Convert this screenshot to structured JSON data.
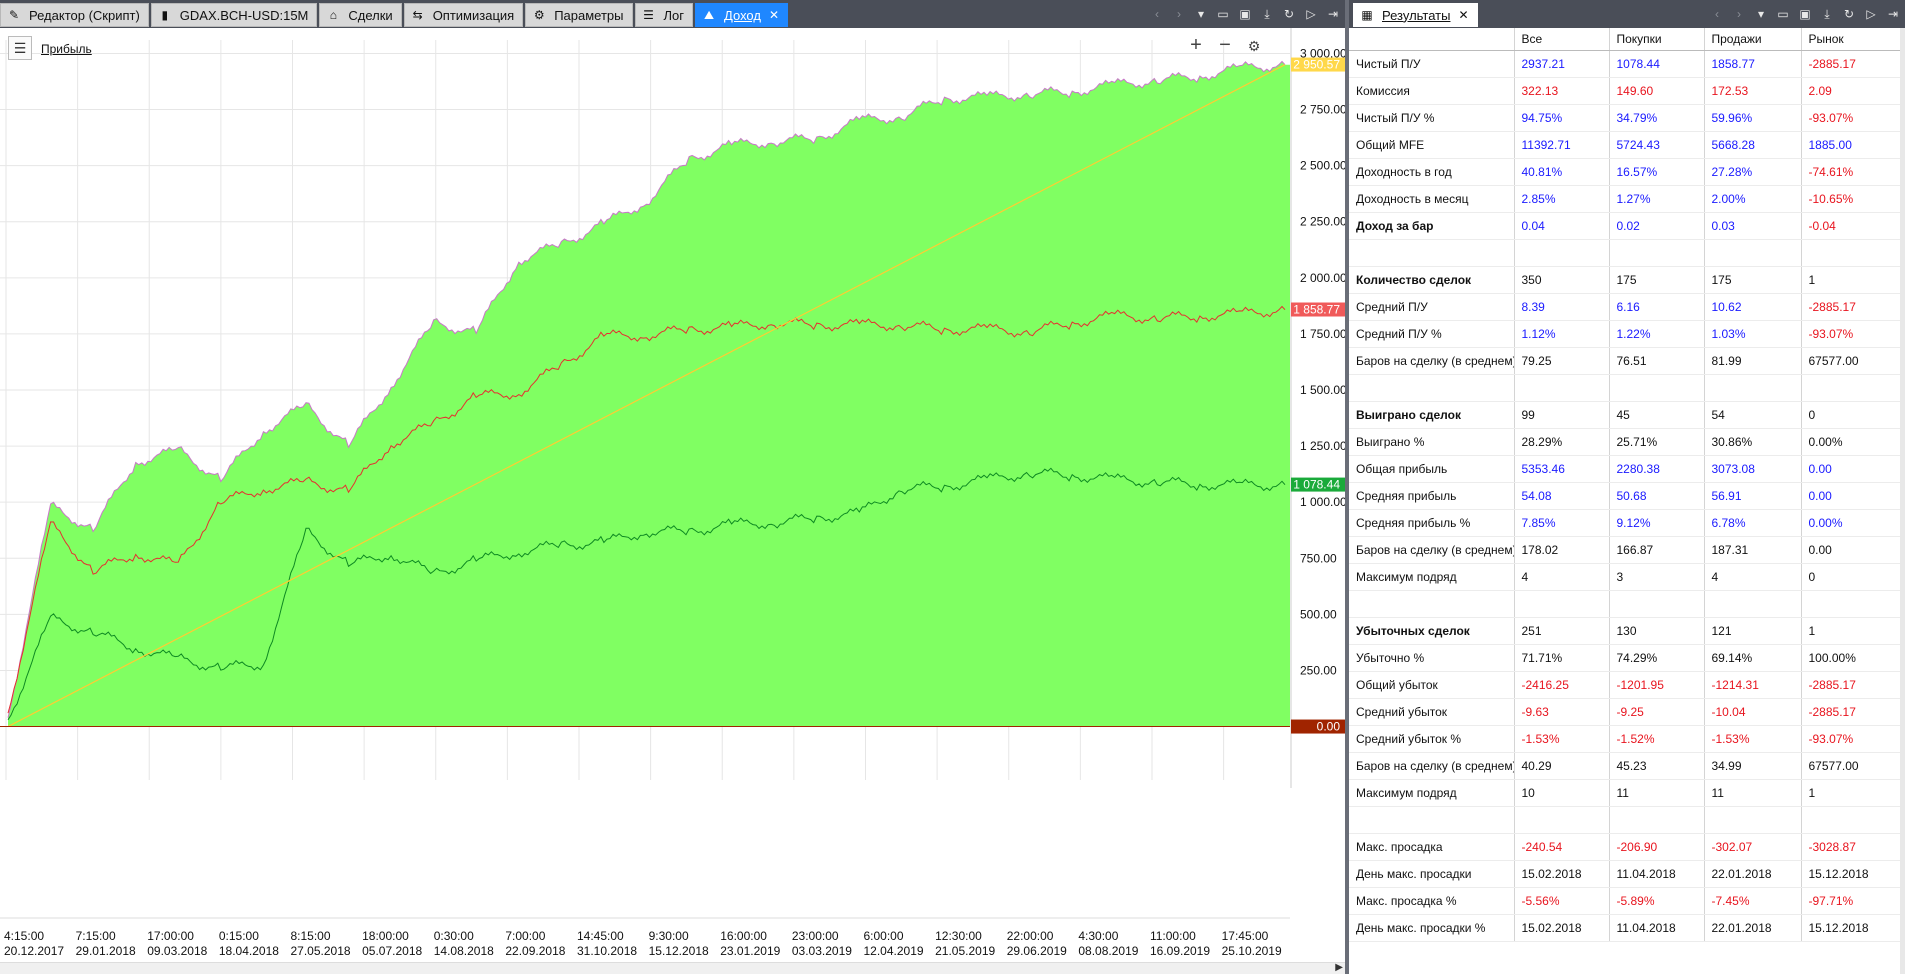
{
  "left_tabs": [
    {
      "label": "Редактор (Скрипт)",
      "icon": "script-editor-icon",
      "glyph": "✎"
    },
    {
      "label": "GDAX.BCH-USD:15M",
      "icon": "candlestick-chart-icon",
      "glyph": "▮"
    },
    {
      "label": "Сделки",
      "icon": "bank-icon",
      "glyph": "⌂"
    },
    {
      "label": "Оптимизация",
      "icon": "optimization-icon",
      "glyph": "⇆"
    },
    {
      "label": "Параметры",
      "icon": "gear-icon",
      "glyph": "⚙"
    },
    {
      "label": "Лог",
      "icon": "list-icon",
      "glyph": "☰"
    },
    {
      "label": "Доход",
      "icon": "income-chart-icon",
      "glyph": "⛰",
      "active": true
    }
  ],
  "right_tab": {
    "label": "Результаты",
    "icon": "results-table-icon"
  },
  "chart": {
    "legend_label": "Прибыль",
    "y_ticks": [
      "3 000.00",
      "2 750.00",
      "2 500.00",
      "2 250.00",
      "2 000.00",
      "1 750.00",
      "1 500.00",
      "1 250.00",
      "1 000.00",
      "750.00",
      "500.00",
      "250.00"
    ],
    "x_ticks": [
      {
        "time": "4:15:00",
        "date": "20.12.2017"
      },
      {
        "time": "7:15:00",
        "date": "29.01.2018"
      },
      {
        "time": "17:00:00",
        "date": "09.03.2018"
      },
      {
        "time": "0:15:00",
        "date": "18.04.2018"
      },
      {
        "time": "8:15:00",
        "date": "27.05.2018"
      },
      {
        "time": "18:00:00",
        "date": "05.07.2018"
      },
      {
        "time": "0:30:00",
        "date": "14.08.2018"
      },
      {
        "time": "7:00:00",
        "date": "22.09.2018"
      },
      {
        "time": "14:45:00",
        "date": "31.10.2018"
      },
      {
        "time": "9:30:00",
        "date": "15.12.2018"
      },
      {
        "time": "16:00:00",
        "date": "23.01.2019"
      },
      {
        "time": "23:00:00",
        "date": "03.03.2019"
      },
      {
        "time": "6:00:00",
        "date": "12.04.2019"
      },
      {
        "time": "12:30:00",
        "date": "21.05.2019"
      },
      {
        "time": "22:00:00",
        "date": "29.06.2019"
      },
      {
        "time": "4:30:00",
        "date": "08.08.2019"
      },
      {
        "time": "11:00:00",
        "date": "16.09.2019"
      },
      {
        "time": "17:45:00",
        "date": "25.10.2019"
      }
    ],
    "value_badges": [
      {
        "text": "2 950.57",
        "color": "#ffd84a",
        "value": 2950.57
      },
      {
        "text": "1 858.77",
        "color": "#f05a5a",
        "value": 1858.77
      },
      {
        "text": "1 078.44",
        "color": "#1aaa3a",
        "value": 1078.44
      },
      {
        "text": "0.00",
        "color": "#a02400",
        "value": 0
      }
    ],
    "colors": {
      "area": "#80ff62",
      "total_line": "#c878c8",
      "sells": "#e53030",
      "buys": "#0e8a22",
      "trend": "#ffcc33"
    }
  },
  "chart_data": {
    "type": "area",
    "ylim": [
      -60,
      3060
    ],
    "series": [
      {
        "name": "Все",
        "values": [
          40,
          980,
          880,
          1180,
          1230,
          1100,
          1320,
          1430,
          1250,
          1520,
          1800,
          1755,
          2080,
          2150,
          2240,
          2340,
          2530,
          2590,
          2610,
          2620,
          2700,
          2720,
          2800,
          2805,
          2820,
          2830,
          2860,
          2880,
          2900,
          2935,
          2950
        ]
      },
      {
        "name": "Продажи",
        "values": [
          60,
          900,
          690,
          770,
          720,
          1000,
          1060,
          1090,
          1050,
          1260,
          1350,
          1470,
          1490,
          1610,
          1740,
          1745,
          1770,
          1780,
          1800,
          1790,
          1790,
          1790,
          1770,
          1770,
          1760,
          1800,
          1830,
          1820,
          1830,
          1840,
          1858
        ]
      },
      {
        "name": "Покупки",
        "values": [
          30,
          480,
          420,
          350,
          300,
          260,
          280,
          870,
          720,
          770,
          680,
          740,
          780,
          810,
          820,
          870,
          870,
          900,
          910,
          930,
          950,
          1060,
          1070,
          1100,
          1130,
          1120,
          1100,
          1090,
          1080,
          1075,
          1078
        ]
      },
      {
        "name": "Тренд",
        "values": [
          0,
          2950
        ]
      }
    ]
  },
  "results": {
    "headers": [
      "",
      "Все",
      "Покупки",
      "Продажи",
      "Рынок"
    ],
    "rows": [
      {
        "label": "Чистый П/У",
        "bold": false,
        "cells": [
          [
            "2937.21",
            "blue"
          ],
          [
            "1078.44",
            "blue"
          ],
          [
            "1858.77",
            "blue"
          ],
          [
            "-2885.17",
            "red"
          ]
        ]
      },
      {
        "label": "Комиссия",
        "bold": false,
        "cells": [
          [
            "322.13",
            "red"
          ],
          [
            "149.60",
            "red"
          ],
          [
            "172.53",
            "red"
          ],
          [
            "2.09",
            "red"
          ]
        ]
      },
      {
        "label": "Чистый П/У %",
        "bold": false,
        "cells": [
          [
            "94.75%",
            "blue"
          ],
          [
            "34.79%",
            "blue"
          ],
          [
            "59.96%",
            "blue"
          ],
          [
            "-93.07%",
            "red"
          ]
        ]
      },
      {
        "label": "Общий MFE",
        "bold": false,
        "cells": [
          [
            "11392.71",
            "blue"
          ],
          [
            "5724.43",
            "blue"
          ],
          [
            "5668.28",
            "blue"
          ],
          [
            "1885.00",
            "blue"
          ]
        ]
      },
      {
        "label": "Доходность в год",
        "bold": false,
        "cells": [
          [
            "40.81%",
            "blue"
          ],
          [
            "16.57%",
            "blue"
          ],
          [
            "27.28%",
            "blue"
          ],
          [
            "-74.61%",
            "red"
          ]
        ]
      },
      {
        "label": "Доходность в месяц",
        "bold": false,
        "cells": [
          [
            "2.85%",
            "blue"
          ],
          [
            "1.27%",
            "blue"
          ],
          [
            "2.00%",
            "blue"
          ],
          [
            "-10.65%",
            "red"
          ]
        ]
      },
      {
        "label": "Доход за бар",
        "bold": true,
        "cells": [
          [
            "0.04",
            "blue"
          ],
          [
            "0.02",
            "blue"
          ],
          [
            "0.03",
            "blue"
          ],
          [
            "-0.04",
            "red"
          ]
        ]
      },
      {
        "label": "",
        "bold": false,
        "cells": [
          [
            "",
            ""
          ],
          [
            "",
            ""
          ],
          [
            "",
            ""
          ],
          [
            "",
            ""
          ]
        ]
      },
      {
        "label": "Количество сделок",
        "bold": true,
        "cells": [
          [
            "350",
            "black"
          ],
          [
            "175",
            "black"
          ],
          [
            "175",
            "black"
          ],
          [
            "1",
            "black"
          ]
        ]
      },
      {
        "label": "Средний П/У",
        "bold": false,
        "cells": [
          [
            "8.39",
            "blue"
          ],
          [
            "6.16",
            "blue"
          ],
          [
            "10.62",
            "blue"
          ],
          [
            "-2885.17",
            "red"
          ]
        ]
      },
      {
        "label": "Средний П/У %",
        "bold": false,
        "cells": [
          [
            "1.12%",
            "blue"
          ],
          [
            "1.22%",
            "blue"
          ],
          [
            "1.03%",
            "blue"
          ],
          [
            "-93.07%",
            "red"
          ]
        ]
      },
      {
        "label": "Баров на сделку (в среднем)",
        "bold": false,
        "cells": [
          [
            "79.25",
            "black"
          ],
          [
            "76.51",
            "black"
          ],
          [
            "81.99",
            "black"
          ],
          [
            "67577.00",
            "black"
          ]
        ]
      },
      {
        "label": "",
        "bold": false,
        "cells": [
          [
            "",
            ""
          ],
          [
            "",
            ""
          ],
          [
            "",
            ""
          ],
          [
            "",
            ""
          ]
        ]
      },
      {
        "label": "Выиграно сделок",
        "bold": true,
        "cells": [
          [
            "99",
            "black"
          ],
          [
            "45",
            "black"
          ],
          [
            "54",
            "black"
          ],
          [
            "0",
            "black"
          ]
        ]
      },
      {
        "label": "Выиграно %",
        "bold": false,
        "cells": [
          [
            "28.29%",
            "black"
          ],
          [
            "25.71%",
            "black"
          ],
          [
            "30.86%",
            "black"
          ],
          [
            "0.00%",
            "black"
          ]
        ]
      },
      {
        "label": "Общая прибыль",
        "bold": false,
        "cells": [
          [
            "5353.46",
            "blue"
          ],
          [
            "2280.38",
            "blue"
          ],
          [
            "3073.08",
            "blue"
          ],
          [
            "0.00",
            "blue"
          ]
        ]
      },
      {
        "label": "Средняя прибыль",
        "bold": false,
        "cells": [
          [
            "54.08",
            "blue"
          ],
          [
            "50.68",
            "blue"
          ],
          [
            "56.91",
            "blue"
          ],
          [
            "0.00",
            "blue"
          ]
        ]
      },
      {
        "label": "Средняя прибыль %",
        "bold": false,
        "cells": [
          [
            "7.85%",
            "blue"
          ],
          [
            "9.12%",
            "blue"
          ],
          [
            "6.78%",
            "blue"
          ],
          [
            "0.00%",
            "blue"
          ]
        ]
      },
      {
        "label": "Баров на сделку (в среднем)",
        "bold": false,
        "cells": [
          [
            "178.02",
            "black"
          ],
          [
            "166.87",
            "black"
          ],
          [
            "187.31",
            "black"
          ],
          [
            "0.00",
            "black"
          ]
        ]
      },
      {
        "label": "Максимум подряд",
        "bold": false,
        "cells": [
          [
            "4",
            "black"
          ],
          [
            "3",
            "black"
          ],
          [
            "4",
            "black"
          ],
          [
            "0",
            "black"
          ]
        ]
      },
      {
        "label": "",
        "bold": false,
        "cells": [
          [
            "",
            ""
          ],
          [
            "",
            ""
          ],
          [
            "",
            ""
          ],
          [
            "",
            ""
          ]
        ]
      },
      {
        "label": "Убыточных сделок",
        "bold": true,
        "cells": [
          [
            "251",
            "black"
          ],
          [
            "130",
            "black"
          ],
          [
            "121",
            "black"
          ],
          [
            "1",
            "black"
          ]
        ]
      },
      {
        "label": "Убыточно %",
        "bold": false,
        "cells": [
          [
            "71.71%",
            "black"
          ],
          [
            "74.29%",
            "black"
          ],
          [
            "69.14%",
            "black"
          ],
          [
            "100.00%",
            "black"
          ]
        ]
      },
      {
        "label": "Общий убыток",
        "bold": false,
        "cells": [
          [
            "-2416.25",
            "red"
          ],
          [
            "-1201.95",
            "red"
          ],
          [
            "-1214.31",
            "red"
          ],
          [
            "-2885.17",
            "red"
          ]
        ]
      },
      {
        "label": "Средний убыток",
        "bold": false,
        "cells": [
          [
            "-9.63",
            "red"
          ],
          [
            "-9.25",
            "red"
          ],
          [
            "-10.04",
            "red"
          ],
          [
            "-2885.17",
            "red"
          ]
        ]
      },
      {
        "label": "Средний убыток %",
        "bold": false,
        "cells": [
          [
            "-1.53%",
            "red"
          ],
          [
            "-1.52%",
            "red"
          ],
          [
            "-1.53%",
            "red"
          ],
          [
            "-93.07%",
            "red"
          ]
        ]
      },
      {
        "label": "Баров на сделку (в среднем)",
        "bold": false,
        "cells": [
          [
            "40.29",
            "black"
          ],
          [
            "45.23",
            "black"
          ],
          [
            "34.99",
            "black"
          ],
          [
            "67577.00",
            "black"
          ]
        ]
      },
      {
        "label": "Максимум подряд",
        "bold": false,
        "cells": [
          [
            "10",
            "black"
          ],
          [
            "11",
            "black"
          ],
          [
            "11",
            "black"
          ],
          [
            "1",
            "black"
          ]
        ]
      },
      {
        "label": "",
        "bold": false,
        "cells": [
          [
            "",
            ""
          ],
          [
            "",
            ""
          ],
          [
            "",
            ""
          ],
          [
            "",
            ""
          ]
        ]
      },
      {
        "label": "Макс. просадка",
        "bold": false,
        "cells": [
          [
            "-240.54",
            "red"
          ],
          [
            "-206.90",
            "red"
          ],
          [
            "-302.07",
            "red"
          ],
          [
            "-3028.87",
            "red"
          ]
        ]
      },
      {
        "label": "День макс. просадки",
        "bold": false,
        "cells": [
          [
            "15.02.2018",
            "black"
          ],
          [
            "11.04.2018",
            "black"
          ],
          [
            "22.01.2018",
            "black"
          ],
          [
            "15.12.2018",
            "black"
          ]
        ]
      },
      {
        "label": "Макс. просадка %",
        "bold": false,
        "cells": [
          [
            "-5.56%",
            "red"
          ],
          [
            "-5.89%",
            "red"
          ],
          [
            "-7.45%",
            "red"
          ],
          [
            "-97.71%",
            "red"
          ]
        ]
      },
      {
        "label": "День макс. просадки %",
        "bold": false,
        "cells": [
          [
            "15.02.2018",
            "black"
          ],
          [
            "11.04.2018",
            "black"
          ],
          [
            "22.01.2018",
            "black"
          ],
          [
            "15.12.2018",
            "black"
          ]
        ]
      }
    ]
  }
}
